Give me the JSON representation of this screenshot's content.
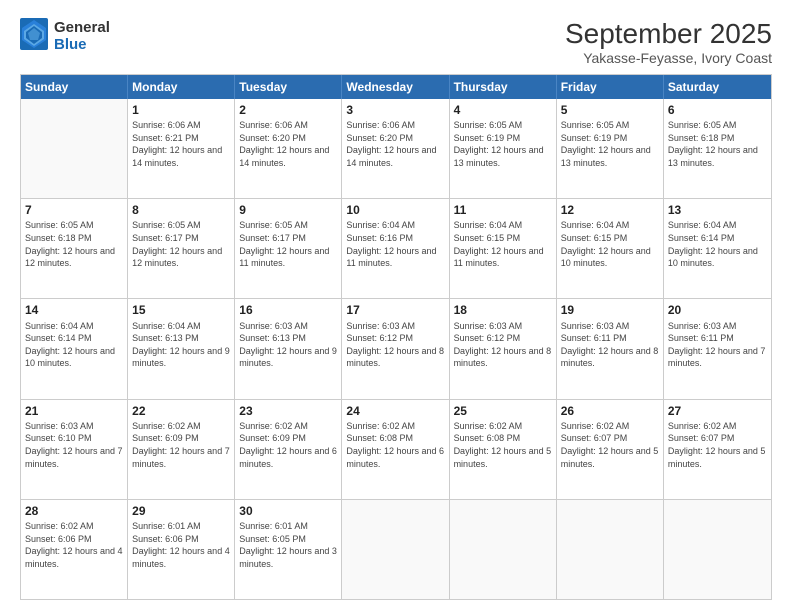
{
  "header": {
    "logo_line1": "General",
    "logo_line2": "Blue",
    "month": "September 2025",
    "location": "Yakasse-Feyasse, Ivory Coast"
  },
  "days_of_week": [
    "Sunday",
    "Monday",
    "Tuesday",
    "Wednesday",
    "Thursday",
    "Friday",
    "Saturday"
  ],
  "weeks": [
    [
      {
        "day": "",
        "empty": true
      },
      {
        "day": "1",
        "sunrise": "Sunrise: 6:06 AM",
        "sunset": "Sunset: 6:21 PM",
        "daylight": "Daylight: 12 hours and 14 minutes."
      },
      {
        "day": "2",
        "sunrise": "Sunrise: 6:06 AM",
        "sunset": "Sunset: 6:20 PM",
        "daylight": "Daylight: 12 hours and 14 minutes."
      },
      {
        "day": "3",
        "sunrise": "Sunrise: 6:06 AM",
        "sunset": "Sunset: 6:20 PM",
        "daylight": "Daylight: 12 hours and 14 minutes."
      },
      {
        "day": "4",
        "sunrise": "Sunrise: 6:05 AM",
        "sunset": "Sunset: 6:19 PM",
        "daylight": "Daylight: 12 hours and 13 minutes."
      },
      {
        "day": "5",
        "sunrise": "Sunrise: 6:05 AM",
        "sunset": "Sunset: 6:19 PM",
        "daylight": "Daylight: 12 hours and 13 minutes."
      },
      {
        "day": "6",
        "sunrise": "Sunrise: 6:05 AM",
        "sunset": "Sunset: 6:18 PM",
        "daylight": "Daylight: 12 hours and 13 minutes."
      }
    ],
    [
      {
        "day": "7",
        "sunrise": "Sunrise: 6:05 AM",
        "sunset": "Sunset: 6:18 PM",
        "daylight": "Daylight: 12 hours and 12 minutes."
      },
      {
        "day": "8",
        "sunrise": "Sunrise: 6:05 AM",
        "sunset": "Sunset: 6:17 PM",
        "daylight": "Daylight: 12 hours and 12 minutes."
      },
      {
        "day": "9",
        "sunrise": "Sunrise: 6:05 AM",
        "sunset": "Sunset: 6:17 PM",
        "daylight": "Daylight: 12 hours and 11 minutes."
      },
      {
        "day": "10",
        "sunrise": "Sunrise: 6:04 AM",
        "sunset": "Sunset: 6:16 PM",
        "daylight": "Daylight: 12 hours and 11 minutes."
      },
      {
        "day": "11",
        "sunrise": "Sunrise: 6:04 AM",
        "sunset": "Sunset: 6:15 PM",
        "daylight": "Daylight: 12 hours and 11 minutes."
      },
      {
        "day": "12",
        "sunrise": "Sunrise: 6:04 AM",
        "sunset": "Sunset: 6:15 PM",
        "daylight": "Daylight: 12 hours and 10 minutes."
      },
      {
        "day": "13",
        "sunrise": "Sunrise: 6:04 AM",
        "sunset": "Sunset: 6:14 PM",
        "daylight": "Daylight: 12 hours and 10 minutes."
      }
    ],
    [
      {
        "day": "14",
        "sunrise": "Sunrise: 6:04 AM",
        "sunset": "Sunset: 6:14 PM",
        "daylight": "Daylight: 12 hours and 10 minutes."
      },
      {
        "day": "15",
        "sunrise": "Sunrise: 6:04 AM",
        "sunset": "Sunset: 6:13 PM",
        "daylight": "Daylight: 12 hours and 9 minutes."
      },
      {
        "day": "16",
        "sunrise": "Sunrise: 6:03 AM",
        "sunset": "Sunset: 6:13 PM",
        "daylight": "Daylight: 12 hours and 9 minutes."
      },
      {
        "day": "17",
        "sunrise": "Sunrise: 6:03 AM",
        "sunset": "Sunset: 6:12 PM",
        "daylight": "Daylight: 12 hours and 8 minutes."
      },
      {
        "day": "18",
        "sunrise": "Sunrise: 6:03 AM",
        "sunset": "Sunset: 6:12 PM",
        "daylight": "Daylight: 12 hours and 8 minutes."
      },
      {
        "day": "19",
        "sunrise": "Sunrise: 6:03 AM",
        "sunset": "Sunset: 6:11 PM",
        "daylight": "Daylight: 12 hours and 8 minutes."
      },
      {
        "day": "20",
        "sunrise": "Sunrise: 6:03 AM",
        "sunset": "Sunset: 6:11 PM",
        "daylight": "Daylight: 12 hours and 7 minutes."
      }
    ],
    [
      {
        "day": "21",
        "sunrise": "Sunrise: 6:03 AM",
        "sunset": "Sunset: 6:10 PM",
        "daylight": "Daylight: 12 hours and 7 minutes."
      },
      {
        "day": "22",
        "sunrise": "Sunrise: 6:02 AM",
        "sunset": "Sunset: 6:09 PM",
        "daylight": "Daylight: 12 hours and 7 minutes."
      },
      {
        "day": "23",
        "sunrise": "Sunrise: 6:02 AM",
        "sunset": "Sunset: 6:09 PM",
        "daylight": "Daylight: 12 hours and 6 minutes."
      },
      {
        "day": "24",
        "sunrise": "Sunrise: 6:02 AM",
        "sunset": "Sunset: 6:08 PM",
        "daylight": "Daylight: 12 hours and 6 minutes."
      },
      {
        "day": "25",
        "sunrise": "Sunrise: 6:02 AM",
        "sunset": "Sunset: 6:08 PM",
        "daylight": "Daylight: 12 hours and 5 minutes."
      },
      {
        "day": "26",
        "sunrise": "Sunrise: 6:02 AM",
        "sunset": "Sunset: 6:07 PM",
        "daylight": "Daylight: 12 hours and 5 minutes."
      },
      {
        "day": "27",
        "sunrise": "Sunrise: 6:02 AM",
        "sunset": "Sunset: 6:07 PM",
        "daylight": "Daylight: 12 hours and 5 minutes."
      }
    ],
    [
      {
        "day": "28",
        "sunrise": "Sunrise: 6:02 AM",
        "sunset": "Sunset: 6:06 PM",
        "daylight": "Daylight: 12 hours and 4 minutes."
      },
      {
        "day": "29",
        "sunrise": "Sunrise: 6:01 AM",
        "sunset": "Sunset: 6:06 PM",
        "daylight": "Daylight: 12 hours and 4 minutes."
      },
      {
        "day": "30",
        "sunrise": "Sunrise: 6:01 AM",
        "sunset": "Sunset: 6:05 PM",
        "daylight": "Daylight: 12 hours and 3 minutes."
      },
      {
        "day": "",
        "empty": true
      },
      {
        "day": "",
        "empty": true
      },
      {
        "day": "",
        "empty": true
      },
      {
        "day": "",
        "empty": true
      }
    ]
  ]
}
